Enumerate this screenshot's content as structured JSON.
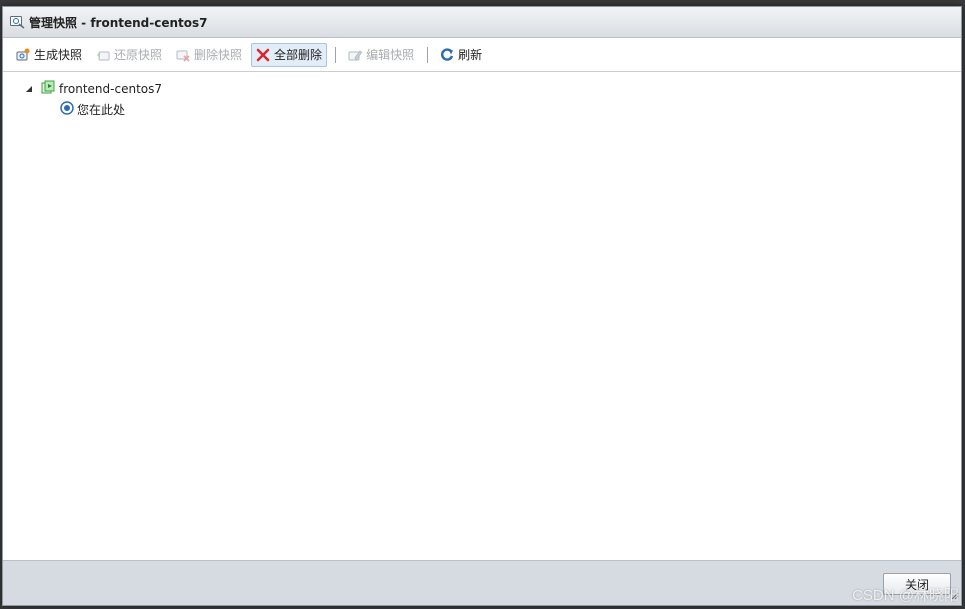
{
  "window": {
    "title": "管理快照 - frontend-centos7"
  },
  "toolbar": {
    "create_label": "生成快照",
    "revert_label": "还原快照",
    "delete_label": "删除快照",
    "delete_all_label": "全部删除",
    "edit_label": "编辑快照",
    "refresh_label": "刷新"
  },
  "tree": {
    "vm_name": "frontend-centos7",
    "current_label": "您在此处"
  },
  "footer": {
    "close_label": "关闭"
  },
  "watermark": "CSDN @林晓阳",
  "colors": {
    "accent_blue": "#2a6db5",
    "delete_red": "#d9272e",
    "vm_green": "#3aa63a",
    "footer_bg": "#d6dbe2"
  },
  "icons": {
    "title": "snapshot-manager-icon",
    "create": "camera-create-icon",
    "revert": "revert-snapshot-icon",
    "delete": "delete-snapshot-icon",
    "delete_all": "red-x-icon",
    "edit": "edit-snapshot-icon",
    "refresh": "refresh-icon",
    "vm": "vm-icon",
    "current": "you-are-here-icon"
  }
}
